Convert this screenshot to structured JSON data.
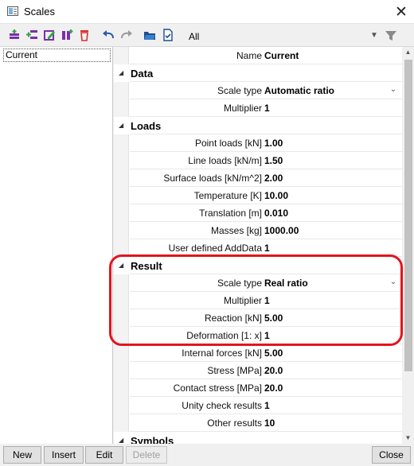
{
  "window": {
    "title": "Scales"
  },
  "toolbar": {
    "filter_value": "All"
  },
  "list": {
    "items": [
      "Current"
    ]
  },
  "properties": {
    "name_label": "Name",
    "name_value": "Current",
    "groups": {
      "data": "Data",
      "loads": "Loads",
      "result": "Result",
      "symbols": "Symbols"
    },
    "data": {
      "scale_type_label": "Scale type",
      "scale_type_value": "Automatic ratio",
      "multiplier_label": "Multiplier",
      "multiplier_value": "1"
    },
    "loads": {
      "point_label": "Point loads [kN]",
      "point_value": "1.00",
      "line_label": "Line loads [kN/m]",
      "line_value": "1.50",
      "surface_label": "Surface loads [kN/m^2]",
      "surface_value": "2.00",
      "temperature_label": "Temperature [K]",
      "temperature_value": "10.00",
      "translation_label": "Translation [m]",
      "translation_value": "0.010",
      "masses_label": "Masses [kg]",
      "masses_value": "1000.00",
      "userdata_label": "User defined AddData",
      "userdata_value": "1"
    },
    "result": {
      "scale_type_label": "Scale type",
      "scale_type_value": "Real ratio",
      "multiplier_label": "Multiplier",
      "multiplier_value": "1",
      "reaction_label": "Reaction [kN]",
      "reaction_value": "5.00",
      "deformation_label": "Deformation [1: x]",
      "deformation_value": "1",
      "internal_label": "Internal forces [kN]",
      "internal_value": "5.00",
      "stress_label": "Stress [MPa]",
      "stress_value": "20.0",
      "contact_label": "Contact stress [MPa]",
      "contact_value": "20.0",
      "unity_label": "Unity check results",
      "unity_value": "1",
      "other_label": "Other results",
      "other_value": "10"
    }
  },
  "buttons": {
    "new": "New",
    "insert": "Insert",
    "edit": "Edit",
    "delete": "Delete",
    "close": "Close"
  },
  "colors": {
    "highlight": "#e3141c",
    "accent_purple": "#7b2fa8",
    "accent_red": "#d9312b"
  }
}
